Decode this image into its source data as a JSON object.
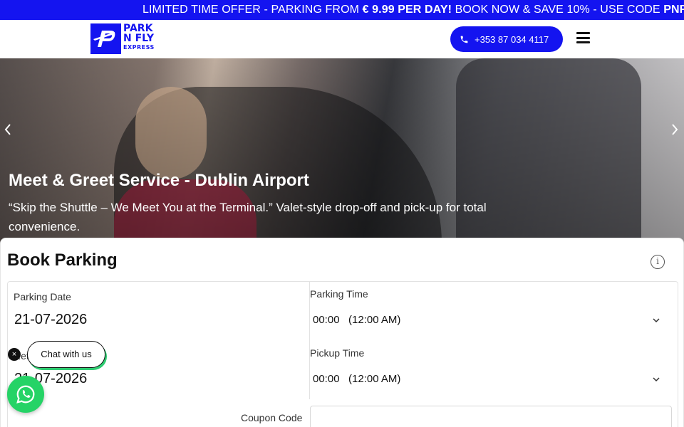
{
  "promo": {
    "part1": "LIMITED TIME OFFER - PARKING FROM ",
    "price": "€ 9.99 PER DAY!",
    "part2": " BOOK NOW & SAVE 10% - USE CODE ",
    "code": "PNFMAX"
  },
  "header": {
    "logo_line1": "PARK",
    "logo_line2": "N FLY",
    "logo_line3": "EXPRESS",
    "phone": "+353 87 034 4117",
    "menu_icon": "hamburger-icon"
  },
  "hero": {
    "title": "Meet & Greet Service - Dublin Airport",
    "subtitle": "“Skip the Shuttle – We Meet You at the Terminal.” Valet-style drop-off and pick-up for total convenience."
  },
  "booking": {
    "title": "Book Parking",
    "parking_date_label": "Parking Date",
    "parking_date": "21-07-2026",
    "parking_time_label": "Parking Time",
    "parking_time": "00:00   (12:00 AM)",
    "return_date_label": "Return Date",
    "return_date": "21-07-2026",
    "pickup_time_label": "Pickup Time",
    "pickup_time": "00:00   (12:00 AM)",
    "coupon_label": "Coupon Code",
    "coupon_value": ""
  },
  "chat": {
    "label": "Chat with us",
    "close": "×"
  },
  "colors": {
    "brand": "#1414f0",
    "whatsapp": "#25d366"
  }
}
